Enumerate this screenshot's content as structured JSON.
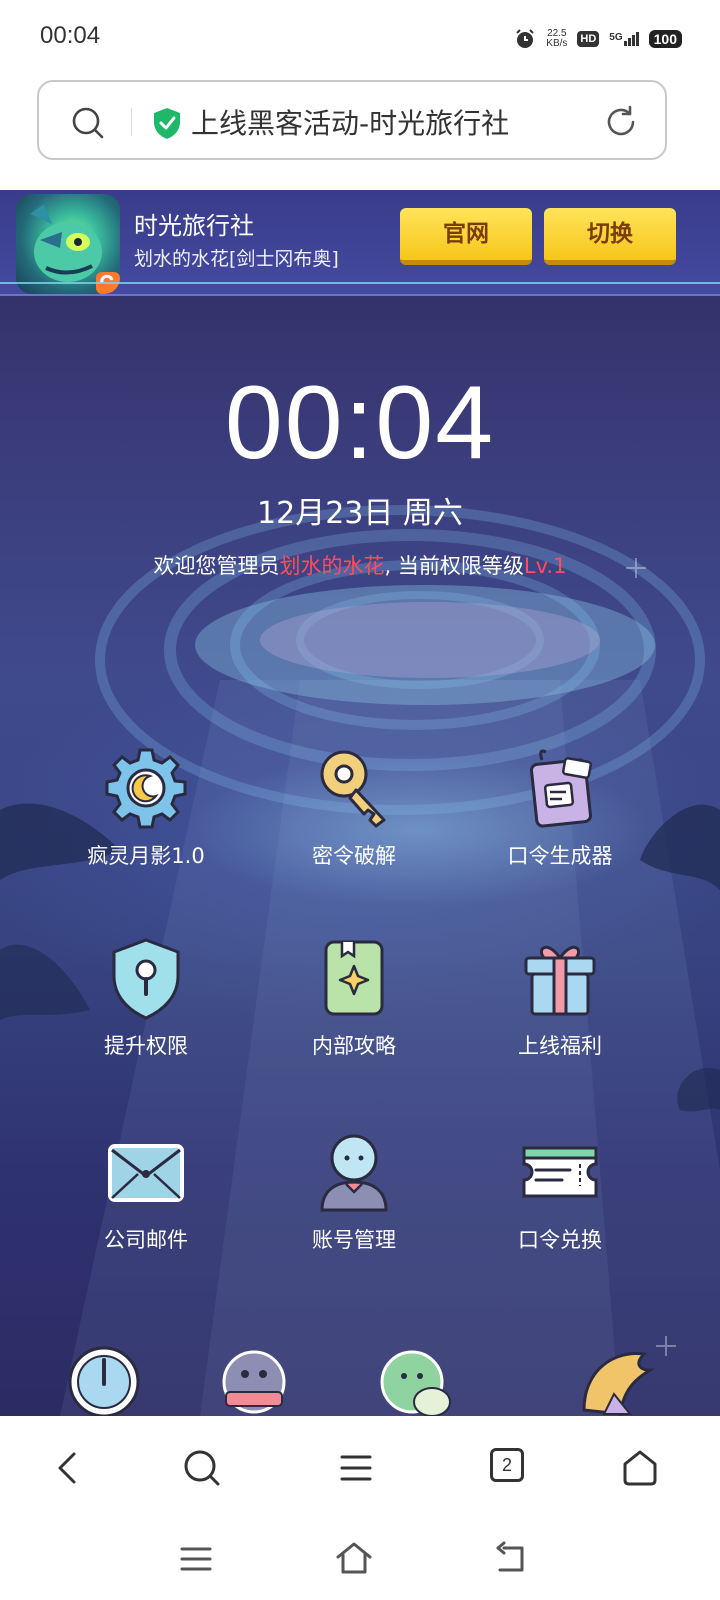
{
  "status_bar": {
    "time": "00:04",
    "net_speed_value": "22.5",
    "net_speed_unit": "KB/s",
    "hd": "HD",
    "network": "5G",
    "battery": "100"
  },
  "address_bar": {
    "title": "上线黑客活动-时光旅行社"
  },
  "game_header": {
    "title": "时光旅行社",
    "subtitle": "划水的水花[剑士冈布奥]",
    "official_button": "官网",
    "switch_button": "切换"
  },
  "main": {
    "clock": "00:04",
    "date": "12月23日 周六",
    "welcome_prefix": "欢迎您管理员",
    "welcome_name": "划水的水花",
    "welcome_middle": ", 当前权限等级",
    "welcome_level": "Lv.1"
  },
  "grid": [
    {
      "label": "疯灵月影1.0",
      "icon": "gear-moon-icon"
    },
    {
      "label": "密令破解",
      "icon": "key-icon"
    },
    {
      "label": "口令生成器",
      "icon": "tag-icon"
    },
    {
      "label": "提升权限",
      "icon": "shield-lock-icon"
    },
    {
      "label": "内部攻略",
      "icon": "guide-book-icon"
    },
    {
      "label": "上线福利",
      "icon": "gift-icon"
    },
    {
      "label": "公司邮件",
      "icon": "envelope-icon"
    },
    {
      "label": "账号管理",
      "icon": "user-icon"
    },
    {
      "label": "口令兑换",
      "icon": "ticket-icon"
    }
  ],
  "browser_nav": {
    "tab_count": "2"
  },
  "colors": {
    "accent_red": "#ff4c5c",
    "button_yellow": "#f7c61a",
    "background_purple": "#3a3a78"
  }
}
